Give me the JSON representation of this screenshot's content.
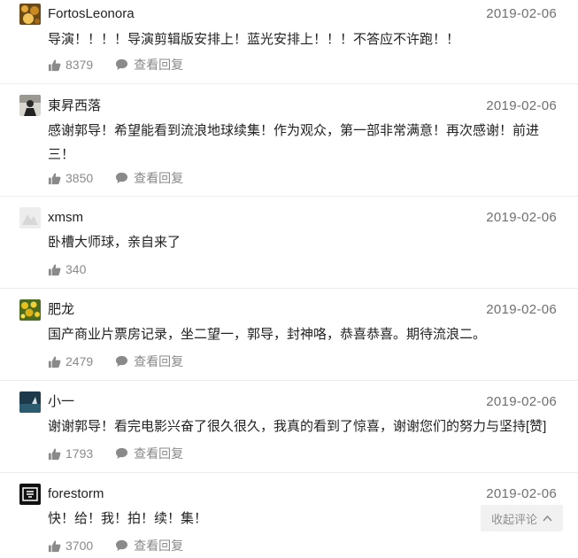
{
  "comments": [
    {
      "username": "FortosLeonora",
      "date": "2019-02-06",
      "text": "导演！！！！导演剪辑版安排上！蓝光安排上！！！不答应不许跑！！",
      "likes": "8379",
      "reply_label": "查看回复",
      "avatar_icon": "golden-pattern-avatar"
    },
    {
      "username": "東昇西落",
      "date": "2019-02-06",
      "text": "感谢郭导！希望能看到流浪地球续集！作为观众，第一部非常满意！再次感谢！前进三！",
      "likes": "3850",
      "reply_label": "查看回复",
      "avatar_icon": "dark-figure-avatar"
    },
    {
      "username": "xmsm",
      "date": "2019-02-06",
      "text": "卧槽大师球，亲自来了",
      "likes": "340",
      "reply_label": "",
      "avatar_icon": "light-gray-avatar"
    },
    {
      "username": "肥龙",
      "date": "2019-02-06",
      "text": "国产商业片票房记录，坐二望一，郭导，封神咯，恭喜恭喜。期待流浪二。",
      "likes": "2479",
      "reply_label": "查看回复",
      "avatar_icon": "yellow-flowers-avatar"
    },
    {
      "username": "小一",
      "date": "2019-02-06",
      "text": "谢谢郭导！看完电影兴奋了很久很久，我真的看到了惊喜，谢谢您们的努力与坚持[赞]",
      "likes": "1793",
      "reply_label": "查看回复",
      "avatar_icon": "dark-sea-avatar"
    },
    {
      "username": "forestorm",
      "date": "2019-02-06",
      "text": "快！给！我！拍！续！集！",
      "likes": "3700",
      "reply_label": "查看回复",
      "avatar_icon": "black-glyph-avatar"
    }
  ],
  "collapse_label": "收起评论",
  "icons": {
    "like": "thumbs-up-icon",
    "reply": "speech-bubble-icon",
    "collapse": "chevron-up-icon"
  },
  "colors": {
    "text": "#222222",
    "meta": "#8a8a8a",
    "divider": "#ececec"
  }
}
